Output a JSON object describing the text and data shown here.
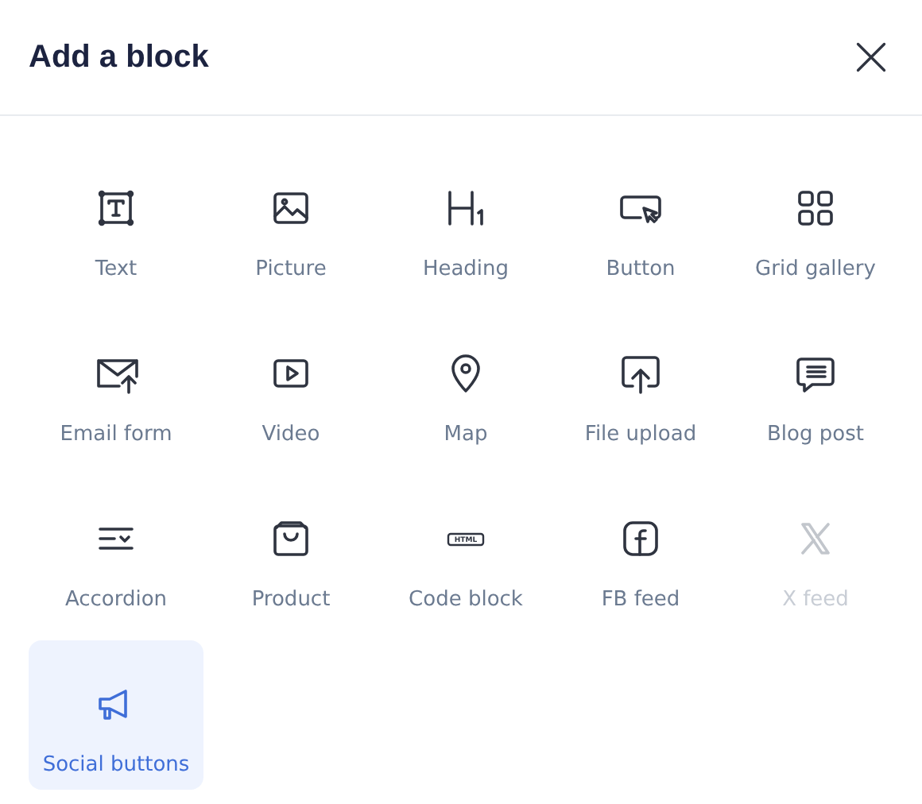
{
  "dialog": {
    "title": "Add a block"
  },
  "blocks": [
    {
      "kind": "text",
      "label": "Text",
      "selected": false,
      "disabled": false
    },
    {
      "kind": "picture",
      "label": "Picture",
      "selected": false,
      "disabled": false
    },
    {
      "kind": "heading",
      "label": "Heading",
      "selected": false,
      "disabled": false
    },
    {
      "kind": "button",
      "label": "Button",
      "selected": false,
      "disabled": false
    },
    {
      "kind": "grid",
      "label": "Grid gallery",
      "selected": false,
      "disabled": false
    },
    {
      "kind": "email",
      "label": "Email form",
      "selected": false,
      "disabled": false
    },
    {
      "kind": "video",
      "label": "Video",
      "selected": false,
      "disabled": false
    },
    {
      "kind": "map",
      "label": "Map",
      "selected": false,
      "disabled": false
    },
    {
      "kind": "upload",
      "label": "File upload",
      "selected": false,
      "disabled": false
    },
    {
      "kind": "blog",
      "label": "Blog post",
      "selected": false,
      "disabled": false
    },
    {
      "kind": "accordion",
      "label": "Accordion",
      "selected": false,
      "disabled": false
    },
    {
      "kind": "product",
      "label": "Product",
      "selected": false,
      "disabled": false
    },
    {
      "kind": "code",
      "label": "Code block",
      "selected": false,
      "disabled": false,
      "icon_text": "HTML"
    },
    {
      "kind": "fb",
      "label": "FB feed",
      "selected": false,
      "disabled": false
    },
    {
      "kind": "x",
      "label": "X feed",
      "selected": false,
      "disabled": true
    },
    {
      "kind": "social",
      "label": "Social buttons",
      "selected": true,
      "disabled": false
    }
  ]
}
